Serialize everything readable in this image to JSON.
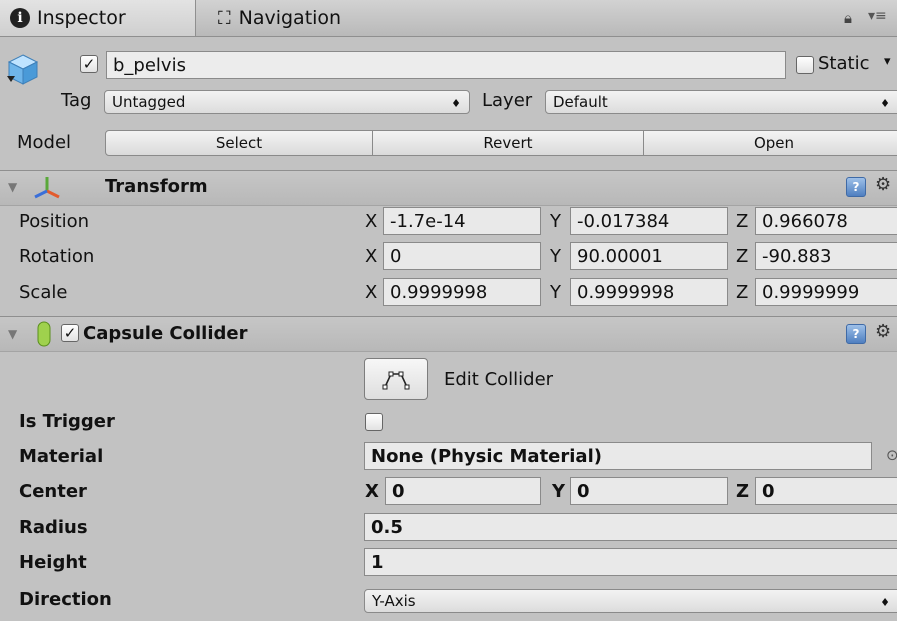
{
  "tabs": [
    {
      "label": "Inspector",
      "icon": "info-icon"
    },
    {
      "label": "Navigation",
      "icon": "navigation-icon"
    }
  ],
  "gameobject": {
    "active": true,
    "name": "b_pelvis",
    "static_label": "Static",
    "static_checked": false,
    "tag_label": "Tag",
    "tag_value": "Untagged",
    "layer_label": "Layer",
    "layer_value": "Default",
    "model_label": "Model",
    "model_buttons": [
      "Select",
      "Revert",
      "Open"
    ]
  },
  "transform": {
    "title": "Transform",
    "rows": [
      {
        "label": "Position",
        "x": "-1.7e-14",
        "y": "-0.017384",
        "z": "0.966078"
      },
      {
        "label": "Rotation",
        "x": "0",
        "y": "90.00001",
        "z": "-90.883"
      },
      {
        "label": "Scale",
        "x": "0.9999998",
        "y": "0.9999998",
        "z": "0.9999999"
      }
    ],
    "axis_labels": [
      "X",
      "Y",
      "Z"
    ]
  },
  "capsule_collider": {
    "title": "Capsule Collider",
    "enabled": true,
    "edit_collider_label": "Edit Collider",
    "is_trigger_label": "Is Trigger",
    "is_trigger": false,
    "material_label": "Material",
    "material_value": "None (Physic Material)",
    "center_label": "Center",
    "center": {
      "x": "0",
      "y": "0",
      "z": "0"
    },
    "radius_label": "Radius",
    "radius_value": "0.5",
    "height_label": "Height",
    "height_value": "1",
    "direction_label": "Direction",
    "direction_value": "Y-Axis"
  },
  "colors": {
    "panel_bg": "#c2c2c2",
    "field_bg": "#e9e9e9",
    "help_icon": "#4f7fc0"
  }
}
